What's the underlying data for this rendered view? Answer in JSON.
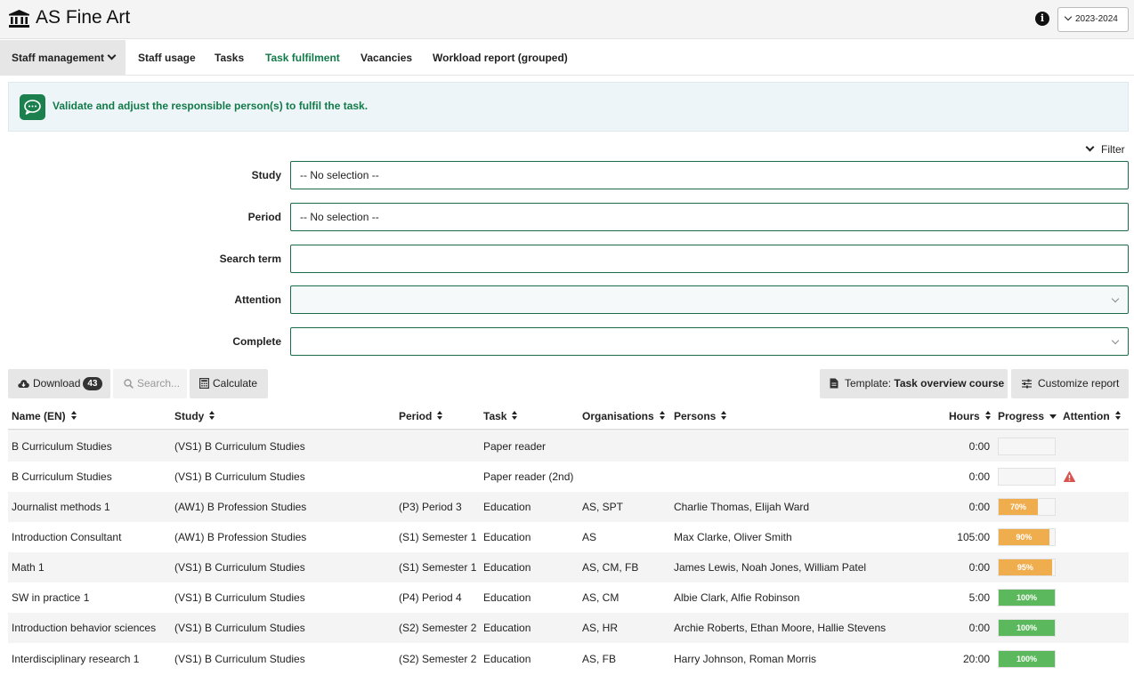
{
  "app": {
    "title": "AS Fine Art",
    "year_selector": "2023-2024"
  },
  "nav": {
    "dropdown_label": "Staff management",
    "items": [
      "Staff usage",
      "Tasks",
      "Task fulfilment",
      "Vacancies",
      "Workload report (grouped)"
    ],
    "active": "Task fulfilment"
  },
  "alert": {
    "text": "Validate and adjust the responsible person(s) to fulfil the task."
  },
  "filter": {
    "toggle_label": "Filter",
    "fields": [
      {
        "label": "Study",
        "value": "-- No selection --",
        "type": "text"
      },
      {
        "label": "Period",
        "value": "-- No selection --",
        "type": "text"
      },
      {
        "label": "Search term",
        "value": "",
        "type": "text"
      },
      {
        "label": "Attention",
        "value": "",
        "type": "select"
      },
      {
        "label": "Complete",
        "value": "",
        "type": "select"
      }
    ]
  },
  "toolbar": {
    "download_label": "Download",
    "download_count": "43",
    "search_placeholder": "Search...",
    "calculate_label": "Calculate",
    "template_prefix": "Template:",
    "template_name": "Task overview course",
    "customize_label": "Customize report"
  },
  "table": {
    "columns": [
      "Name (EN)",
      "Study",
      "Period",
      "Task",
      "Organisations",
      "Persons",
      "Hours",
      "Progress",
      "Attention"
    ],
    "rows": [
      {
        "name": "B Curriculum Studies",
        "study": "(VS1) B Curriculum Studies",
        "period": "",
        "task": "Paper reader",
        "orgs": "",
        "persons": "",
        "hours": "0:00",
        "progress": 0,
        "progress_label": "",
        "attention": false
      },
      {
        "name": "B Curriculum Studies",
        "study": "(VS1) B Curriculum Studies",
        "period": "",
        "task": "Paper reader (2nd)",
        "orgs": "",
        "persons": "",
        "hours": "0:00",
        "progress": 0,
        "progress_label": "",
        "attention": true
      },
      {
        "name": "Journalist methods 1",
        "study": "(AW1) B Profession Studies",
        "period": "(P3) Period 3",
        "task": "Education",
        "orgs": "AS, SPT",
        "persons": "Charlie Thomas, Elijah Ward",
        "hours": "0:00",
        "progress": 70,
        "progress_label": "70%",
        "attention": false
      },
      {
        "name": "Introduction Consultant",
        "study": "(AW1) B Profession Studies",
        "period": "(S1) Semester 1",
        "task": "Education",
        "orgs": "AS",
        "persons": "Max Clarke, Oliver Smith",
        "hours": "105:00",
        "progress": 90,
        "progress_label": "90%",
        "attention": false
      },
      {
        "name": "Math 1",
        "study": "(VS1) B Curriculum Studies",
        "period": "(S1) Semester 1",
        "task": "Education",
        "orgs": "AS, CM, FB",
        "persons": "James Lewis, Noah Jones, William Patel",
        "hours": "0:00",
        "progress": 95,
        "progress_label": "95%",
        "attention": false
      },
      {
        "name": "SW in practice 1",
        "study": "(VS1) B Curriculum Studies",
        "period": "(P4) Period 4",
        "task": "Education",
        "orgs": "AS, CM",
        "persons": "Albie Clark, Alfie Robinson",
        "hours": "5:00",
        "progress": 100,
        "progress_label": "100%",
        "attention": false
      },
      {
        "name": "Introduction behavior sciences",
        "study": "(VS1) B Curriculum Studies",
        "period": "(S2) Semester 2",
        "task": "Education",
        "orgs": "AS, HR",
        "persons": "Archie Roberts, Ethan Moore, Hallie Stevens",
        "hours": "0:00",
        "progress": 100,
        "progress_label": "100%",
        "attention": false
      },
      {
        "name": "Interdisciplinary research 1",
        "study": "(VS1) B Curriculum Studies",
        "period": "(S2) Semester 2",
        "task": "Education",
        "orgs": "AS, FB",
        "persons": "Harry Johnson, Roman Morris",
        "hours": "20:00",
        "progress": 100,
        "progress_label": "100%",
        "attention": false
      }
    ]
  },
  "colors": {
    "brand_green": "#127a49",
    "progress_partial": "#f0ad4e",
    "progress_complete": "#5cb85c",
    "attention_red": "#d9534f"
  }
}
